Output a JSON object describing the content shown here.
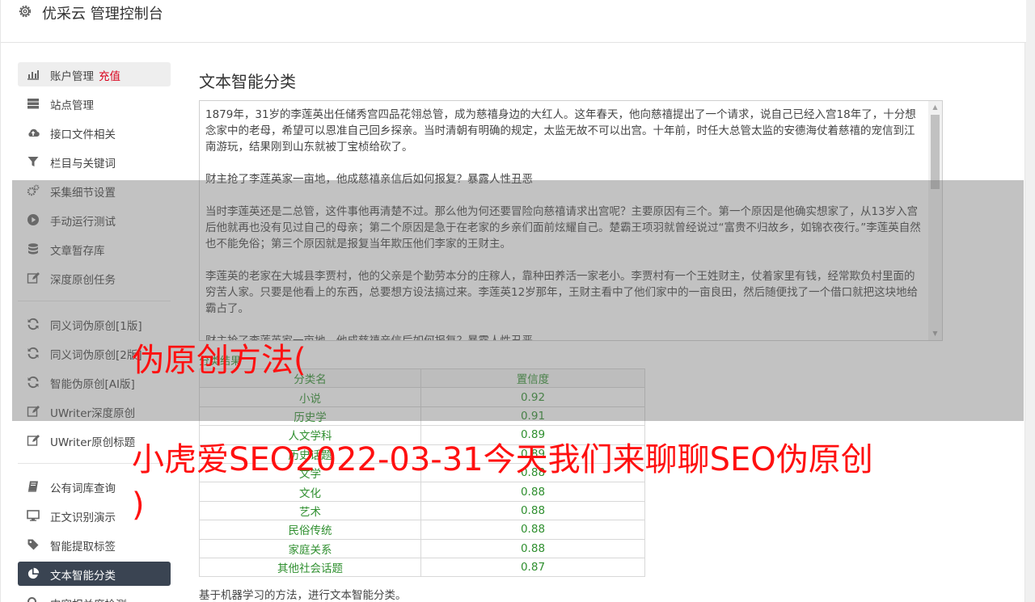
{
  "header": {
    "icon": "gear-icon",
    "title": "优采云 管理控制台"
  },
  "sidebar": {
    "items": [
      {
        "label": "账户管理",
        "tag": "充值",
        "icon": "bar-chart-icon"
      },
      {
        "label": "站点管理",
        "icon": "server-icon"
      },
      {
        "label": "接口文件相关",
        "icon": "cloud-upload-icon"
      },
      {
        "label": "栏目与关键词",
        "icon": "filter-icon"
      },
      {
        "label": "采集细节设置",
        "icon": "gears-icon"
      },
      {
        "label": "手动运行测试",
        "icon": "play-circle-icon"
      },
      {
        "label": "文章暂存库",
        "icon": "database-icon"
      },
      {
        "label": "深度原创任务",
        "icon": "edit-icon"
      },
      {
        "label": "同义词伪原创[1版]",
        "icon": "refresh-icon"
      },
      {
        "label": "同义词伪原创[2版]",
        "icon": "refresh-icon"
      },
      {
        "label": "智能伪原创[AI版]",
        "icon": "refresh-icon"
      },
      {
        "label": "UWriter深度原创",
        "icon": "edit-icon"
      },
      {
        "label": "UWriter原创标题",
        "icon": "edit-icon"
      },
      {
        "label": "公有词库查询",
        "icon": "book-icon"
      },
      {
        "label": "正文识别演示",
        "icon": "monitor-icon"
      },
      {
        "label": "智能提取标签",
        "icon": "tag-icon"
      },
      {
        "label": "文本智能分类",
        "icon": "pie-chart-icon"
      },
      {
        "label": "内容相关度检测",
        "icon": "search-icon"
      }
    ]
  },
  "main": {
    "title": "文本智能分类",
    "paragraphs": [
      "1879年，31岁的李莲英出任储秀宫四品花翎总管，成为慈禧身边的大红人。这年春天，他向慈禧提出了一个请求，说自己已经入宫18年了，十分想念家中的老母，希望可以恩准自己回乡探亲。当时清朝有明确的规定，太监无故不可以出宫。十年前，时任大总管太监的安德海仗着慈禧的宠信到江南游玩，结果刚到山东就被丁宝桢给砍了。",
      "财主抢了李莲英家一亩地，他成慈禧亲信后如何报复？暴露人性丑恶",
      "当时李莲英还是二总管，这件事他再清楚不过。那么他为何还要冒险向慈禧请求出宫呢？主要原因有三个。第一个原因是他确实想家了，从13岁入宫后他就再也没有见过自己的母亲；第二个原因是急于在老家的乡亲们面前炫耀自己。楚霸王项羽就曾经说过“富贵不归故乡，如锦衣夜行。”李莲英自然也不能免俗；第三个原因就是报复当年欺压他们李家的王财主。",
      "李莲英的老家在大城县李贾村，他的父亲是个勤劳本分的庄稼人，靠种田养活一家老小。李贾村有一个王姓财主，仗着家里有钱，经常欺负村里面的穷苦人家。只要是他看上的东西，总要想方设法搞过来。李莲英12岁那年，王财主看中了他们家中的一亩良田，然后随便找了一个借口就把这块地给霸占了。",
      "财主抢了李莲英家一亩地，他成慈禧亲信后如何报复？暴露人性丑恶"
    ],
    "result_label": "分类结果",
    "table": {
      "headers": [
        "分类名",
        "置信度"
      ],
      "rows": [
        [
          "小说",
          "0.92"
        ],
        [
          "历史学",
          "0.91"
        ],
        [
          "人文学科",
          "0.89"
        ],
        [
          "历史话题",
          "0.89"
        ],
        [
          "文学",
          "0.88"
        ],
        [
          "文化",
          "0.88"
        ],
        [
          "艺术",
          "0.88"
        ],
        [
          "民俗传统",
          "0.88"
        ],
        [
          "家庭关系",
          "0.88"
        ],
        [
          "其他社会话题",
          "0.87"
        ]
      ]
    },
    "footer_note": "基于机器学习的方法，进行文本智能分类。"
  },
  "overlay": {
    "line1": "伪原创方法(",
    "line2": "小虎爱SEO2022-03-31今天我们来聊聊SEO伪原创",
    "line3": ")"
  }
}
